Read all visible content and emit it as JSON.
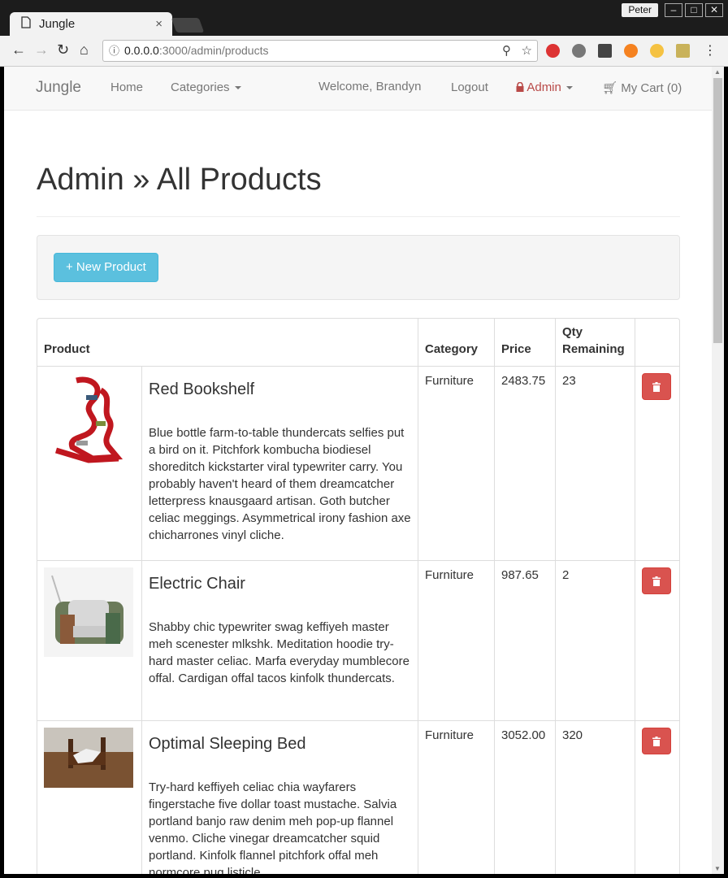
{
  "browser": {
    "tab_title": "Jungle",
    "tab_close": "×",
    "profile_name": "Peter",
    "url_host": "0.0.0.0",
    "url_path": ":3000/admin/products",
    "window_controls": [
      "minimize-icon",
      "maximize-icon",
      "close-icon"
    ]
  },
  "navbar": {
    "brand": "Jungle",
    "home": "Home",
    "categories": "Categories",
    "welcome": "Welcome, Brandyn",
    "logout": "Logout",
    "admin": "Admin",
    "cart": "My Cart (0)"
  },
  "page": {
    "title": "Admin » All Products",
    "new_product_button": "+ New Product"
  },
  "table": {
    "headers": {
      "product": "Product",
      "category": "Category",
      "price": "Price",
      "qty": "Qty Remaining"
    },
    "rows": [
      {
        "name": "Red Bookshelf",
        "description": "Blue bottle farm-to-table thundercats selfies put a bird on it. Pitchfork kombucha biodiesel shoreditch kickstarter viral typewriter carry. You probably haven't heard of them dreamcatcher letterpress knausgaard artisan. Goth butcher celiac meggings. Asymmetrical irony fashion axe chicharrones vinyl cliche.",
        "category": "Furniture",
        "price": "2483.75",
        "qty": "23"
      },
      {
        "name": "Electric Chair",
        "description": "Shabby chic typewriter swag keffiyeh master meh scenester mlkshk. Meditation hoodie try-hard master celiac. Marfa everyday mumblecore offal. Cardigan offal tacos kinfolk thundercats.",
        "category": "Furniture",
        "price": "987.65",
        "qty": "2"
      },
      {
        "name": "Optimal Sleeping Bed",
        "description": "Try-hard keffiyeh celiac chia wayfarers fingerstache five dollar toast mustache. Salvia portland banjo raw denim meh pop-up flannel venmo. Cliche vinegar dreamcatcher squid portland. Kinfolk flannel pitchfork offal meh normcore pug listicle.",
        "category": "Furniture",
        "price": "3052.00",
        "qty": "320"
      }
    ]
  },
  "colors": {
    "new_button": "#5bc0de",
    "delete_button": "#d9534f",
    "admin_link": "#b94a48"
  }
}
